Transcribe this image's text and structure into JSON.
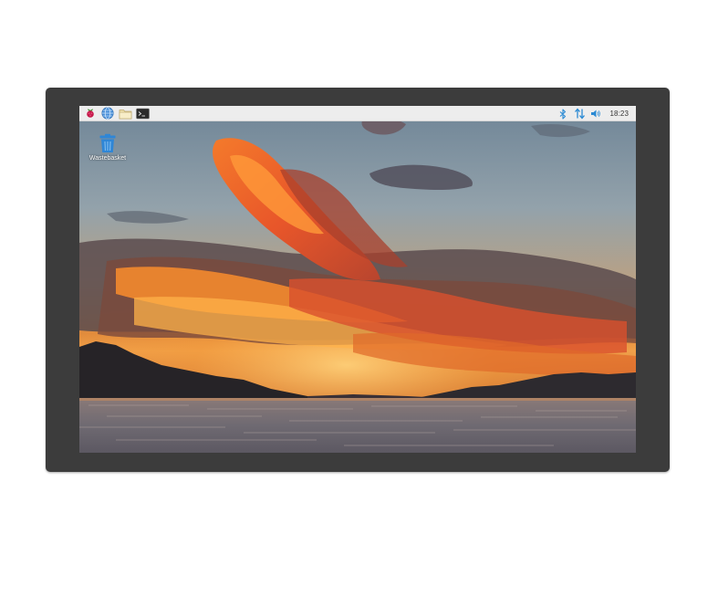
{
  "taskbar": {
    "launchers": [
      {
        "name": "raspberry-menu-icon",
        "interactable": true
      },
      {
        "name": "web-browser-icon",
        "interactable": true
      },
      {
        "name": "file-manager-icon",
        "interactable": true
      },
      {
        "name": "terminal-icon",
        "interactable": true
      }
    ],
    "tray": {
      "bluetooth_icon": "bluetooth-icon",
      "network_icon": "network-arrows-icon",
      "volume_icon": "volume-icon",
      "clock": "18:23"
    }
  },
  "desktop": {
    "icons": [
      {
        "label": "Wastebasket",
        "icon": "wastebasket-icon"
      }
    ]
  },
  "colors": {
    "bezel": "#3c3c3c",
    "taskbar": "#ededed",
    "tray_accent": "#2a8ad4",
    "wastebasket": "#2f86d6"
  }
}
